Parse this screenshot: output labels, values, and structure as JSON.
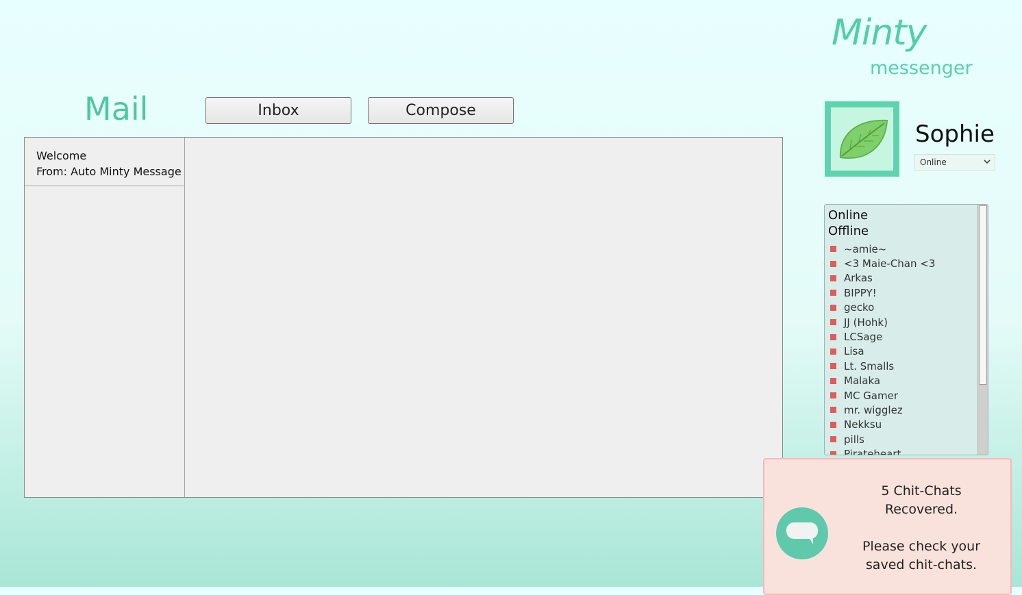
{
  "brand": {
    "name": "Minty",
    "subtitle": "messenger"
  },
  "mail": {
    "title": "Mail",
    "tabs": {
      "inbox": "Inbox",
      "compose": "Compose"
    },
    "messages": [
      {
        "subject": "Welcome",
        "from": "From: Auto Minty Message"
      }
    ]
  },
  "profile": {
    "name": "Sophie",
    "status_selected": "Online",
    "avatar_icon": "mint-leaf-icon"
  },
  "contacts": {
    "groups": {
      "online": "Online",
      "offline": "Offline"
    },
    "offline_list": [
      "~amie~",
      "<3 Maie-Chan <3",
      "Arkas",
      "BIPPY!",
      "gecko",
      "JJ (Hohk)",
      "LCSage",
      "Lisa",
      "Lt. Smalls",
      "Malaka",
      "MC Gamer",
      "mr. wigglez",
      "Nekksu",
      "pills",
      "Pirateheart"
    ],
    "status_color": "#e05b5b"
  },
  "notification": {
    "line1": "5 Chit-Chats",
    "line2": "Recovered.",
    "line3": "Please check your",
    "line4": "saved chit-chats.",
    "icon": "chat-bubble-icon"
  },
  "colors": {
    "accent": "#4fcfa8",
    "panel": "#efefef",
    "notif_bg": "#fae2dc"
  }
}
